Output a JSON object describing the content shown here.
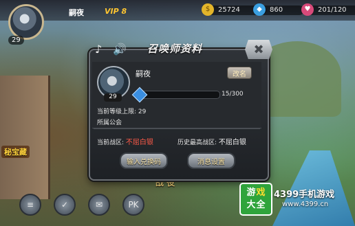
{
  "topbar": {
    "player_name": "嗣夜",
    "vip_label": "VIP 8",
    "avatar_level": "29",
    "resources": [
      {
        "icon": "gold-coin-icon",
        "value": "25724",
        "color": "#e3b52a"
      },
      {
        "icon": "blue-gem-icon",
        "value": "860",
        "color": "#3b9fe0"
      },
      {
        "icon": "stamina-icon",
        "value": "201/120",
        "color": "#d84a7a"
      }
    ]
  },
  "side": {
    "treasure_label": "秘宝藏"
  },
  "map": {
    "battle_label": "战 役"
  },
  "bottom_buttons": [
    {
      "name": "task-button",
      "glyph": "≡"
    },
    {
      "name": "checklist-button",
      "glyph": "✓"
    },
    {
      "name": "mail-button",
      "glyph": "✉"
    },
    {
      "name": "pk-button",
      "glyph": "PK"
    }
  ],
  "dialog": {
    "title": "召唤师资料",
    "music_glyph": "♪",
    "speaker_glyph": "🔊",
    "close_glyph": "✖",
    "player_name": "嗣夜",
    "avatar_level": "29",
    "rename_label": "改名",
    "exp_text": "15/300",
    "exp_fraction": 0.05,
    "level_cap_label": "当前等级上限:",
    "level_cap_value": "29",
    "guild_label": "所属公会",
    "current_zone_label": "当前战区:",
    "current_zone_value": "不屈白银",
    "highest_zone_label": "历史最高战区:",
    "highest_zone_value": "不屈白银",
    "redeem_button": "输入兑换码",
    "message_settings_button": "消息设置"
  },
  "watermark": {
    "box_line1": [
      "游",
      "戏"
    ],
    "box_line2": [
      "大",
      "全"
    ],
    "brand": "4399手机游戏",
    "url": "www.4399.cn"
  }
}
